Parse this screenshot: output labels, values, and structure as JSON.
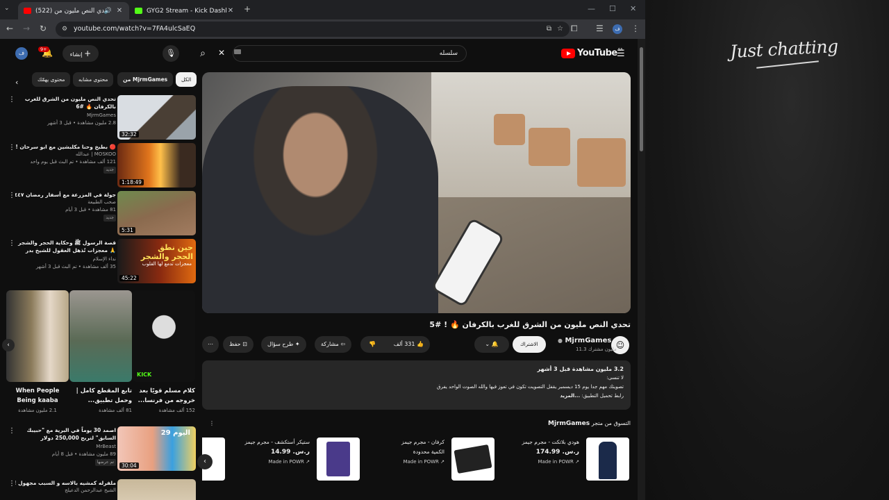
{
  "browser": {
    "tabs": [
      {
        "title": "(522) تحدي النص مليون من",
        "active": true
      },
      {
        "title": "GYG2 Stream - Kick Dashboard",
        "active": false
      }
    ],
    "url": "youtube.com/watch?v=7FA4ulcSaEQ",
    "profile_initial": "ف"
  },
  "masthead": {
    "search_query": "سلسله",
    "create_label": "إنشاء",
    "notification_count": "9+",
    "avatar_initial": "ف",
    "logo_text": "YouTube",
    "country": "SA"
  },
  "video": {
    "title": "تحدي النص مليون من الشرق للغرب بالكرفان 🔥 ! #5",
    "channel": "MjrmGames",
    "subscribers": "11.3 مليون مشترك",
    "subscribe_label": "الاشتراك",
    "likes": "331 ألف",
    "share_label": "مشاركة",
    "ask_label": "طرح سؤال",
    "save_label": "حفظ",
    "description": {
      "meta": "3.2 مليون مشاهدة  قبل 3 أشهر",
      "line1": "لا تنسى:",
      "line2": "تصويتك مهم جدا يوم 15 ديسمبر يقفل التصويت تكون في تعوز فيها والله الصوت الواحد يفرق",
      "line3": "رابط تحميل التطبيق:",
      "more": "...المزيد"
    }
  },
  "shop": {
    "header": "التسوق من متجر",
    "channel": "MjrmGames",
    "products": [
      {
        "name": "هودي بلاتكت - مجرم جيمز",
        "price": "ر.س. 174.99",
        "tag": "Made in POWR"
      },
      {
        "name": "كرفان - مجرم جيمز",
        "price": "الكمية محدودة",
        "tag": "Made in POWR"
      },
      {
        "name": "ستيكر أستكشف - مجرم جيمز",
        "price": "ر.س. 14.99",
        "tag": "Made in POWR"
      }
    ]
  },
  "chips": [
    "الكل",
    "من MjrmGames",
    "محتوى مشابه",
    "محتوى يهمّك"
  ],
  "recommendations": [
    {
      "title": "تحدي النص مليون من الشرق للغرب بالكرفان 🔥 #6",
      "channel": "MjrmGames",
      "meta": "2.8 مليون مشاهدة • قبل 3 أشهر",
      "duration": "32:32",
      "badge": ""
    },
    {
      "title": "🔴 بطبخ وحنا مكلبشين مع ابو سرحان !!",
      "channel": "MOSKOO | عبدالله",
      "meta": "121 ألف مشاهدة • تم البث قبل يوم واحد",
      "duration": "1:18:49",
      "badge": "جديد"
    },
    {
      "title": "جولة في المزرعة مع أسفار رمضان ١٤٤٧",
      "channel": "صحب الطبيعة",
      "meta": "81 مشاهدة • قبل 3 أيام",
      "duration": "5:31",
      "badge": "جديد"
    },
    {
      "title": "قصة الرسول ﷺ وحكاية الحجر والشجر 🙏 معجزات تُذهل العقول للشيخ بدر المشاري",
      "channel": "نداء الإسلام",
      "meta": "35 ألف مشاهدة • تم البث قبل 3 أشهر",
      "duration": "45:22",
      "badge": ""
    },
    {
      "title": "اصمد 30 يوماً في البرية مع \"حبيبك السابق\" لتربح 250,000 دولار",
      "channel": "MrBeast",
      "meta": "89 مليون مشاهدة • قبل 8 أيام",
      "duration": "30:04",
      "badge": "تم عرضها"
    },
    {
      "title": "ملفرله كمشيه بالاسه و السبب مجهول !!",
      "channel": "الشيخ عبدالرحمن الدعيلج",
      "meta": "",
      "duration": "",
      "badge": ""
    }
  ],
  "shorts": [
    {
      "title": "كلام مسلم قويًا بعد خروجه من فرنسا...",
      "views": "152 ألف مشاهدة"
    },
    {
      "title": "تابع المقطع كامل | وحمل تطبيق...",
      "views": "81 ألف مشاهدة"
    },
    {
      "title": "When People Being kaaba",
      "views": "2.1 مليون مشاهدة"
    }
  ],
  "thumb_texts": {
    "rec4": "حين نطق الحجر والشجر",
    "rec4_sub": "معجزات تدمع لها القلوب",
    "rec5": "اليوم 29"
  },
  "side": {
    "watermark": "Just chatting"
  },
  "colors": {
    "background": "#0f0f0f",
    "surface": "#272727",
    "youtube_red": "#ff0000",
    "kick_green": "#53fc18"
  }
}
